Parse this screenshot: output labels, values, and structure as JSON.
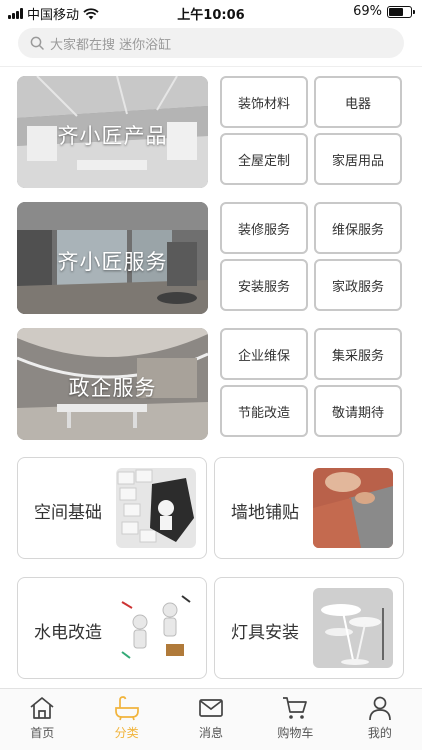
{
  "status_bar": {
    "carrier": "中国移动",
    "time": "上午10:06",
    "battery_percent": "69%",
    "battery_level": 0.69
  },
  "search": {
    "placeholder": "大家都在搜 迷你浴缸"
  },
  "categories": [
    {
      "title": "齐小匠产品",
      "items": [
        "装饰材料",
        "电器",
        "全屋定制",
        "家居用品"
      ]
    },
    {
      "title": "齐小匠服务",
      "items": [
        "装修服务",
        "维保服务",
        "安装服务",
        "家政服务"
      ]
    },
    {
      "title": "政企服务",
      "items": [
        "企业维保",
        "集采服务",
        "节能改造",
        "敬请期待"
      ]
    }
  ],
  "services": [
    {
      "label": "空间基础"
    },
    {
      "label": "墙地铺贴"
    },
    {
      "label": "水电改造"
    },
    {
      "label": "灯具安装"
    }
  ],
  "tabbar": {
    "active_color": "#f1b43c",
    "items": [
      {
        "label": "首页",
        "icon": "home-icon"
      },
      {
        "label": "分类",
        "icon": "bathtub-icon"
      },
      {
        "label": "消息",
        "icon": "mail-icon"
      },
      {
        "label": "购物车",
        "icon": "cart-icon"
      },
      {
        "label": "我的",
        "icon": "person-icon"
      }
    ]
  }
}
